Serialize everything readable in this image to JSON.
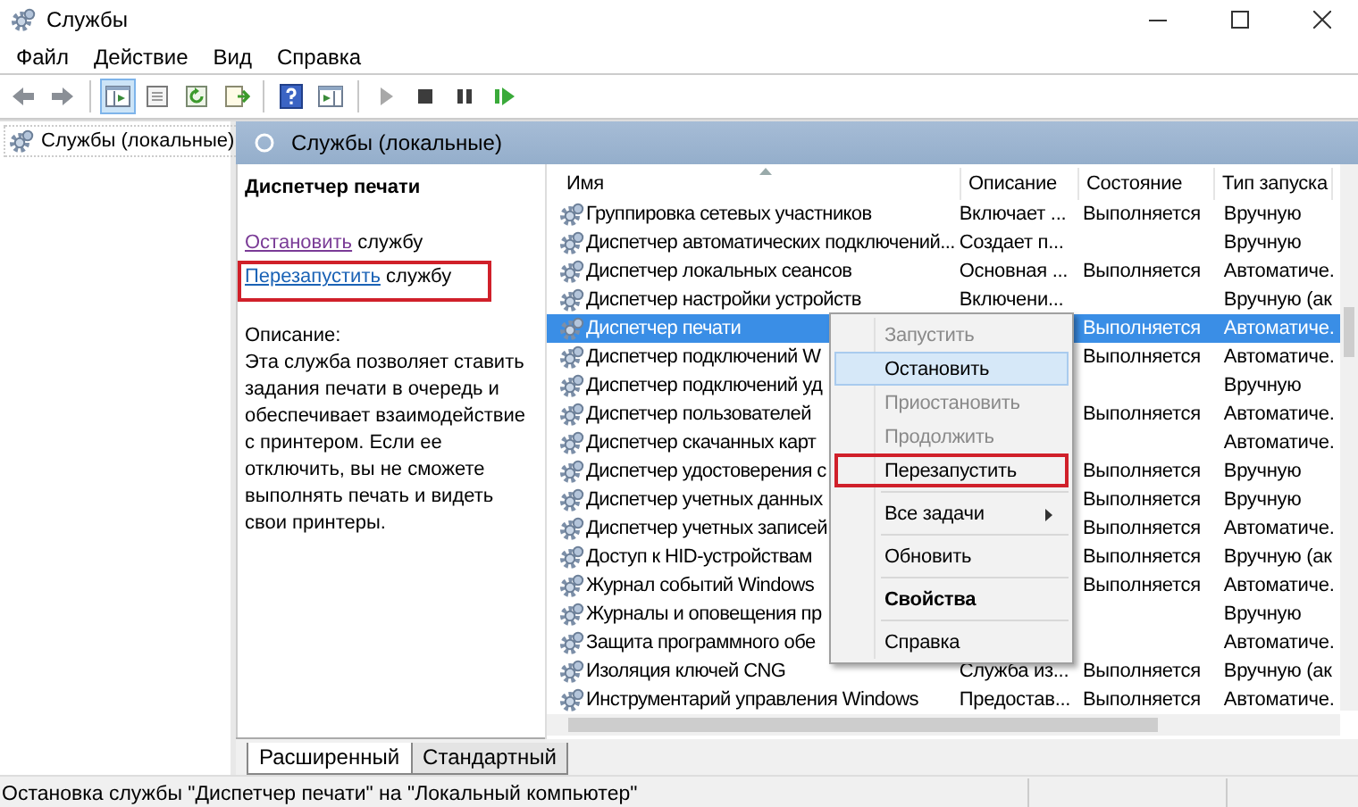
{
  "window": {
    "title": "Службы"
  },
  "menu": [
    {
      "label": "Файл"
    },
    {
      "label": "Действие"
    },
    {
      "label": "Вид"
    },
    {
      "label": "Справка"
    }
  ],
  "toolbar": [
    {
      "kind": "button",
      "pressed": false
    },
    {
      "kind": "button",
      "pressed": false
    },
    {
      "kind": "separator"
    },
    {
      "kind": "button",
      "pressed": true
    },
    {
      "kind": "button",
      "pressed": false
    },
    {
      "kind": "button",
      "pressed": false
    },
    {
      "kind": "button",
      "pressed": false
    },
    {
      "kind": "separator"
    },
    {
      "kind": "button",
      "pressed": false
    },
    {
      "kind": "button",
      "pressed": false
    },
    {
      "kind": "separator"
    },
    {
      "kind": "button",
      "pressed": false,
      "disabled": true
    },
    {
      "kind": "button",
      "pressed": false,
      "disabled": false
    },
    {
      "kind": "button",
      "pressed": false,
      "disabled": false
    },
    {
      "kind": "button",
      "pressed": false,
      "disabled": false
    }
  ],
  "tree": [
    {
      "label": "Службы (локальные)"
    }
  ],
  "panel_header": "Службы (локальные)",
  "details": {
    "title": "Диспетчер печати",
    "actions": [
      {
        "link": "Остановить",
        "text": "службу",
        "visited": true,
        "highlighted": false
      },
      {
        "link": "Перезапустить",
        "text": "службу",
        "visited": false,
        "highlighted": true
      }
    ],
    "description_label": "Описание:",
    "description": "Эта служба позволяет ставить задания печати в очередь и обеспечивает взаимодействие с принтером. Если ее отключить, вы не сможете выполнять печать и видеть свои принтеры."
  },
  "table": {
    "columns": [
      {
        "label": "Имя",
        "sorted": true
      },
      {
        "label": "Описание",
        "sorted": false
      },
      {
        "label": "Состояние",
        "sorted": false
      },
      {
        "label": "Тип запуска",
        "sorted": false
      }
    ],
    "rows": [
      {
        "name": "Группировка сетевых участников",
        "description": "Включает ...",
        "state": "Выполняется",
        "startup": "Вручную",
        "selected": false
      },
      {
        "name": "Диспетчер автоматических подключений...",
        "description": "Создает п...",
        "startup": "Вручную",
        "selected": false
      },
      {
        "name": "Диспетчер локальных сеансов",
        "description": "Основная ...",
        "state": "Выполняется",
        "startup": "Автоматиче.",
        "selected": false
      },
      {
        "name": "Диспетчер настройки устройств",
        "description": "Включени...",
        "startup": "Вручную (ак",
        "selected": false
      },
      {
        "name": "Диспетчер печати",
        "state": "Выполняется",
        "startup": "Автоматиче.",
        "selected": true
      },
      {
        "name": "Диспетчер подключений W",
        "state": "Выполняется",
        "startup": "Автоматиче.",
        "selected": false
      },
      {
        "name": "Диспетчер подключений уд",
        "startup": "Вручную",
        "selected": false
      },
      {
        "name": "Диспетчер пользователей",
        "state": "Выполняется",
        "startup": "Автоматиче.",
        "selected": false
      },
      {
        "name": "Диспетчер скачанных карт",
        "startup": "Автоматиче.",
        "selected": false
      },
      {
        "name": "Диспетчер удостоверения с",
        "state": "Выполняется",
        "startup": "Вручную",
        "selected": false
      },
      {
        "name": "Диспетчер учетных данных",
        "state": "Выполняется",
        "startup": "Вручную",
        "selected": false
      },
      {
        "name": "Диспетчер учетных записей",
        "state": "Выполняется",
        "startup": "Автоматиче.",
        "selected": false
      },
      {
        "name": "Доступ к HID-устройствам",
        "state": "Выполняется",
        "startup": "Вручную (ак",
        "selected": false
      },
      {
        "name": "Журнал событий Windows",
        "state": "Выполняется",
        "startup": "Автоматиче.",
        "selected": false
      },
      {
        "name": "Журналы и оповещения пр",
        "startup": "Вручную",
        "selected": false
      },
      {
        "name": "Защита программного обе",
        "startup": "Автоматиче.",
        "selected": false
      },
      {
        "name": "Изоляция ключей CNG",
        "description": "Служба из...",
        "state": "Выполняется",
        "startup": "Вручную (ак",
        "selected": false
      },
      {
        "name": "Инструментарий управления Windows",
        "description": "Предостав...",
        "state": "Выполняется",
        "startup": "Автоматиче.",
        "selected": false
      }
    ]
  },
  "context_menu": {
    "items": [
      {
        "kind": "item",
        "label": "Запустить",
        "disabled": true,
        "selected": false,
        "highlighted": false,
        "bold": false
      },
      {
        "kind": "item",
        "label": "Остановить",
        "disabled": false,
        "selected": true,
        "highlighted": false,
        "bold": false
      },
      {
        "kind": "item",
        "label": "Приостановить",
        "disabled": true,
        "selected": false,
        "highlighted": false,
        "bold": false
      },
      {
        "kind": "item",
        "label": "Продолжить",
        "disabled": true,
        "selected": false,
        "highlighted": false,
        "bold": false
      },
      {
        "kind": "item",
        "label": "Перезапустить",
        "disabled": false,
        "selected": false,
        "highlighted": true,
        "bold": false
      },
      {
        "kind": "separator"
      },
      {
        "kind": "submenu",
        "label": "Все задачи",
        "disabled": false,
        "selected": false,
        "highlighted": false,
        "bold": false
      },
      {
        "kind": "separator"
      },
      {
        "kind": "item",
        "label": "Обновить",
        "disabled": false,
        "selected": false,
        "highlighted": false,
        "bold": false
      },
      {
        "kind": "separator"
      },
      {
        "kind": "item",
        "label": "Свойства",
        "disabled": false,
        "selected": false,
        "highlighted": false,
        "bold": true
      },
      {
        "kind": "separator"
      },
      {
        "kind": "item",
        "label": "Справка",
        "disabled": false,
        "selected": false,
        "highlighted": false,
        "bold": false
      }
    ]
  },
  "view_tabs": [
    {
      "label": "Расширенный",
      "selected": true
    },
    {
      "label": "Стандартный",
      "selected": false
    }
  ],
  "status_bar": "Остановка службы \"Диспетчер печати\" на \"Локальный компьютер\""
}
